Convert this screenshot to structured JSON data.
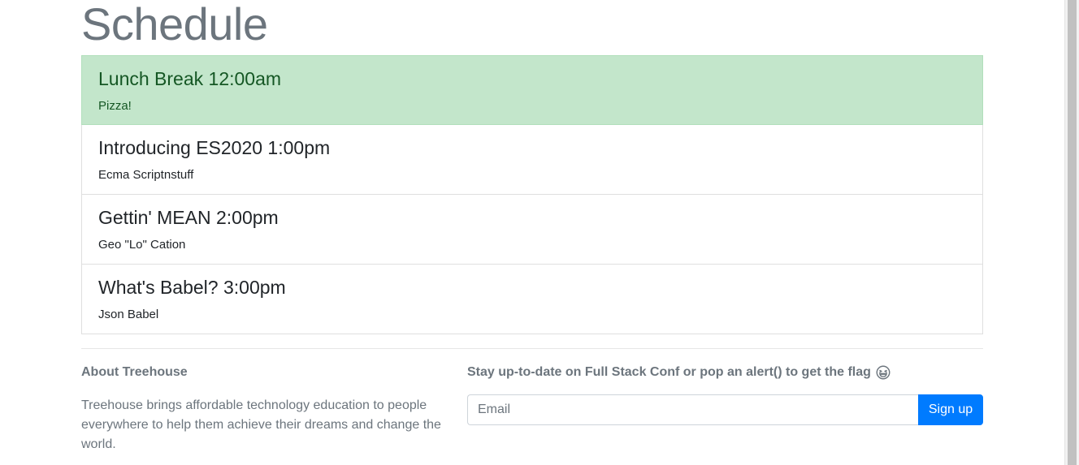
{
  "page": {
    "title": "Schedule"
  },
  "schedule": {
    "items": [
      {
        "title": "Lunch Break 12:00am",
        "description": "Pizza!",
        "active": true
      },
      {
        "title": "Introducing ES2020 1:00pm",
        "description": "Ecma Scriptnstuff",
        "active": false
      },
      {
        "title": "Gettin' MEAN 2:00pm",
        "description": "Geo \"Lo\" Cation",
        "active": false
      },
      {
        "title": "What's Babel? 3:00pm",
        "description": "Json Babel",
        "active": false
      }
    ]
  },
  "footer": {
    "about_title": "About Treehouse",
    "about_text": "Treehouse brings affordable technology education to people everywhere to help them achieve their dreams and change the world.",
    "signup_title": "Stay up-to-date on Full Stack Conf or pop an alert() to get the flag",
    "signup_icon": "grinning-squinting-face-icon",
    "email_placeholder": "Email",
    "email_value": "",
    "signup_button": "Sign up"
  },
  "colors": {
    "active_background": "#c3e6cb",
    "active_text": "#155724",
    "primary_button": "#007bff",
    "muted_text": "#6c757d"
  }
}
